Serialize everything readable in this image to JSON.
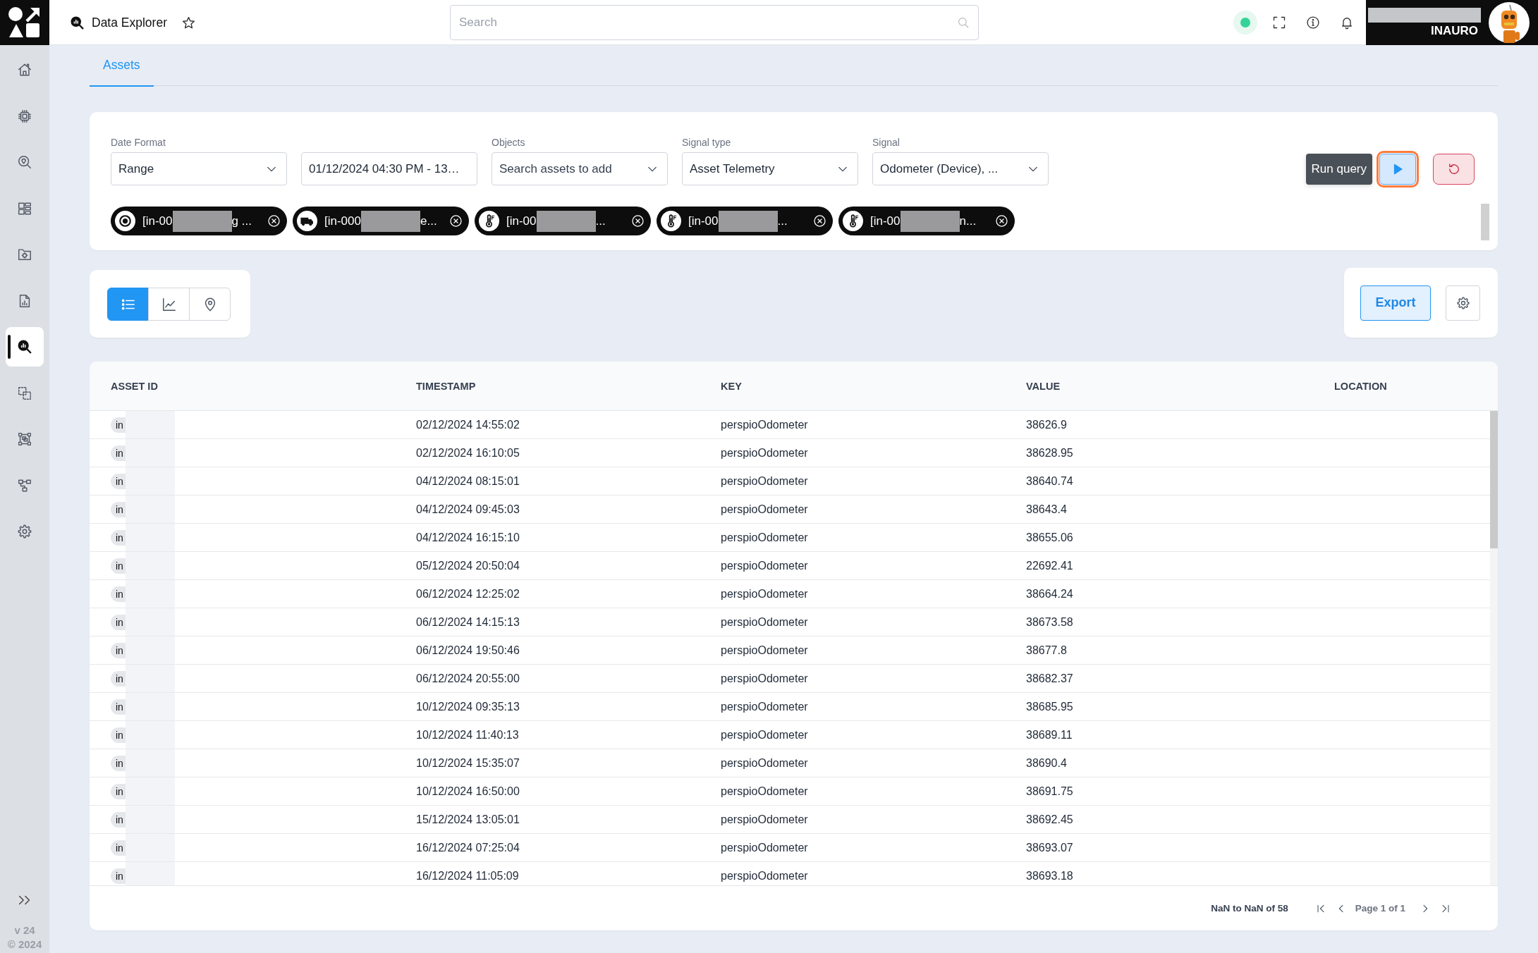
{
  "header": {
    "title": "Data Explorer",
    "starred": false,
    "search": {
      "placeholder": "Search"
    },
    "connected": true,
    "account": {
      "name": "INAURO"
    }
  },
  "sidebar": {
    "items": [
      {
        "kind": "home",
        "selected": false
      },
      {
        "kind": "chip",
        "selected": false
      },
      {
        "kind": "location-search",
        "selected": false
      },
      {
        "kind": "dashboard",
        "selected": false
      },
      {
        "kind": "folder-settings",
        "selected": false
      },
      {
        "kind": "report",
        "selected": false
      },
      {
        "kind": "data-explorer",
        "selected": true
      },
      {
        "kind": "group",
        "selected": false
      },
      {
        "kind": "frame",
        "selected": false
      },
      {
        "kind": "hierarchy",
        "selected": false
      },
      {
        "kind": "settings",
        "selected": false
      }
    ],
    "version": "v 24",
    "copyright": "© 2024"
  },
  "tabs": [
    {
      "label": "Assets",
      "selected": true
    }
  ],
  "filters": {
    "fields": [
      {
        "kind": "select",
        "label": "Date Format",
        "value": "Range"
      },
      {
        "kind": "input",
        "value": "01/12/2024 04:30 PM - 13…"
      },
      {
        "kind": "select",
        "label": "Objects",
        "placeholder": "Search assets to add"
      },
      {
        "kind": "select",
        "label": "Signal type",
        "value": "Asset Telemetry"
      },
      {
        "kind": "select",
        "label": "Signal",
        "value": "Odometer (Device), ..."
      }
    ],
    "run": {
      "tooltip": "Run query",
      "focused": true
    },
    "chips": [
      {
        "kind": "target",
        "text": "[in-00",
        "tail": "g ..."
      },
      {
        "kind": "truck",
        "text": "[in-000",
        "tail": "e..."
      },
      {
        "kind": "thermometer",
        "text": "[in-00",
        "tail": "..."
      },
      {
        "kind": "thermometer",
        "text": "[in-00",
        "tail": "..."
      },
      {
        "kind": "thermometer",
        "text": "[in-00",
        "tail": "n..."
      }
    ]
  },
  "view_modes": [
    {
      "kind": "list",
      "selected": true
    },
    {
      "kind": "line-chart",
      "selected": false
    },
    {
      "kind": "map",
      "selected": false
    }
  ],
  "export": {
    "label": "Export"
  },
  "table": {
    "columns": [
      "ASSET ID",
      "TIMESTAMP",
      "KEY",
      "VALUE",
      "LOCATION"
    ],
    "rows": [
      {
        "asset_id": "in",
        "timestamp": "02/12/2024 14:55:02",
        "key": "perspioOdometer",
        "value": "38626.9"
      },
      {
        "asset_id": "in",
        "timestamp": "02/12/2024 16:10:05",
        "key": "perspioOdometer",
        "value": "38628.95"
      },
      {
        "asset_id": "in",
        "timestamp": "04/12/2024 08:15:01",
        "key": "perspioOdometer",
        "value": "38640.74"
      },
      {
        "asset_id": "in",
        "timestamp": "04/12/2024 09:45:03",
        "key": "perspioOdometer",
        "value": "38643.4"
      },
      {
        "asset_id": "in",
        "timestamp": "04/12/2024 16:15:10",
        "key": "perspioOdometer",
        "value": "38655.06"
      },
      {
        "asset_id": "in",
        "timestamp": "05/12/2024 20:50:04",
        "key": "perspioOdometer",
        "value": "22692.41"
      },
      {
        "asset_id": "in",
        "timestamp": "06/12/2024 12:25:02",
        "key": "perspioOdometer",
        "value": "38664.24"
      },
      {
        "asset_id": "in",
        "timestamp": "06/12/2024 14:15:13",
        "key": "perspioOdometer",
        "value": "38673.58"
      },
      {
        "asset_id": "in",
        "timestamp": "06/12/2024 19:50:46",
        "key": "perspioOdometer",
        "value": "38677.8"
      },
      {
        "asset_id": "in",
        "timestamp": "06/12/2024 20:55:00",
        "key": "perspioOdometer",
        "value": "38682.37"
      },
      {
        "asset_id": "in",
        "timestamp": "10/12/2024 09:35:13",
        "key": "perspioOdometer",
        "value": "38685.95"
      },
      {
        "asset_id": "in",
        "timestamp": "10/12/2024 11:40:13",
        "key": "perspioOdometer",
        "value": "38689.11"
      },
      {
        "asset_id": "in",
        "timestamp": "10/12/2024 15:35:07",
        "key": "perspioOdometer",
        "value": "38690.4"
      },
      {
        "asset_id": "in",
        "timestamp": "10/12/2024 16:50:00",
        "key": "perspioOdometer",
        "value": "38691.75"
      },
      {
        "asset_id": "in",
        "timestamp": "15/12/2024 13:05:01",
        "key": "perspioOdometer",
        "value": "38692.45"
      },
      {
        "asset_id": "in",
        "timestamp": "16/12/2024 07:25:04",
        "key": "perspioOdometer",
        "value": "38693.07"
      },
      {
        "asset_id": "in",
        "timestamp": "16/12/2024 11:05:09",
        "key": "perspioOdometer",
        "value": "38693.18"
      }
    ]
  },
  "pagination": {
    "range": "NaN to NaN of 58",
    "page": "Page 1 of 1"
  }
}
